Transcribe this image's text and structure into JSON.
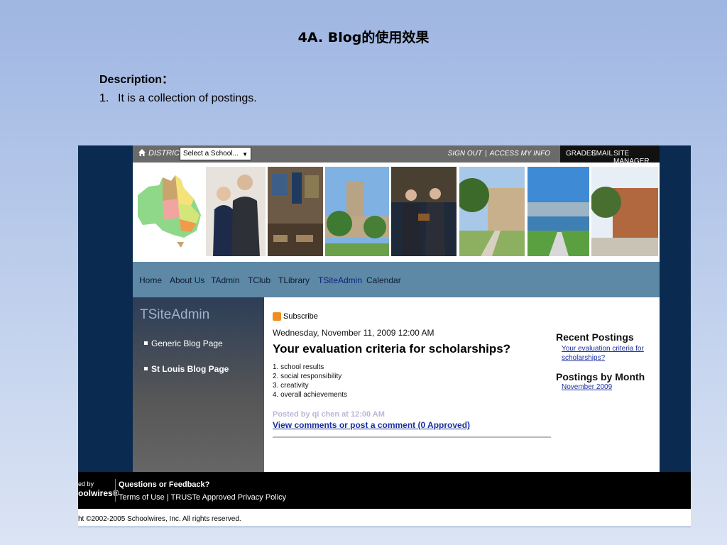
{
  "slide": {
    "title": "4A. Blog的使用效果",
    "description_label": "Description：",
    "items": [
      {
        "num": "1.",
        "text": "It is a collection of postings."
      }
    ]
  },
  "site": {
    "topbar": {
      "district": "DISTRICT",
      "school_select": "Select a School...",
      "links": [
        "SIGN OUT",
        "ACCESS MY INFO"
      ],
      "right_links": [
        "GRADES",
        "EMAIL",
        "SITE MANAGER"
      ]
    },
    "nav": [
      "Home",
      "About Us",
      "TAdmin",
      "TClub",
      "TLibrary",
      "TSiteAdmin",
      "Calendar"
    ],
    "sidebar": {
      "title": "TSiteAdmin",
      "items": [
        "Generic Blog Page",
        "St Louis Blog Page"
      ]
    },
    "post": {
      "subscribe": "Subscribe",
      "date": "Wednesday, November 11, 2009 12:00 AM",
      "title": "Your evaluation criteria for scholarships?",
      "list": [
        "1. school results",
        "2. social responsibility",
        "3. creativity",
        "4. overall achievements"
      ],
      "posted_by": "Posted by qi chen at 12:00 AM",
      "comments_link": "View comments or post a comment (0 Approved)"
    },
    "right_panel": {
      "recent_title": "Recent Postings",
      "recent_link": "Your evaluation criteria for scholarships?",
      "month_title": "Postings by Month",
      "month_link": "November 2009"
    },
    "footer": {
      "by": "ed by",
      "logo": "oolwires®",
      "questions": "Questions or Feedback?",
      "terms": "Terms of Use | TRUSTe Approved Privacy Policy",
      "copyright": "ht ©2002-2005 Schoolwires, Inc. All rights reserved."
    }
  }
}
